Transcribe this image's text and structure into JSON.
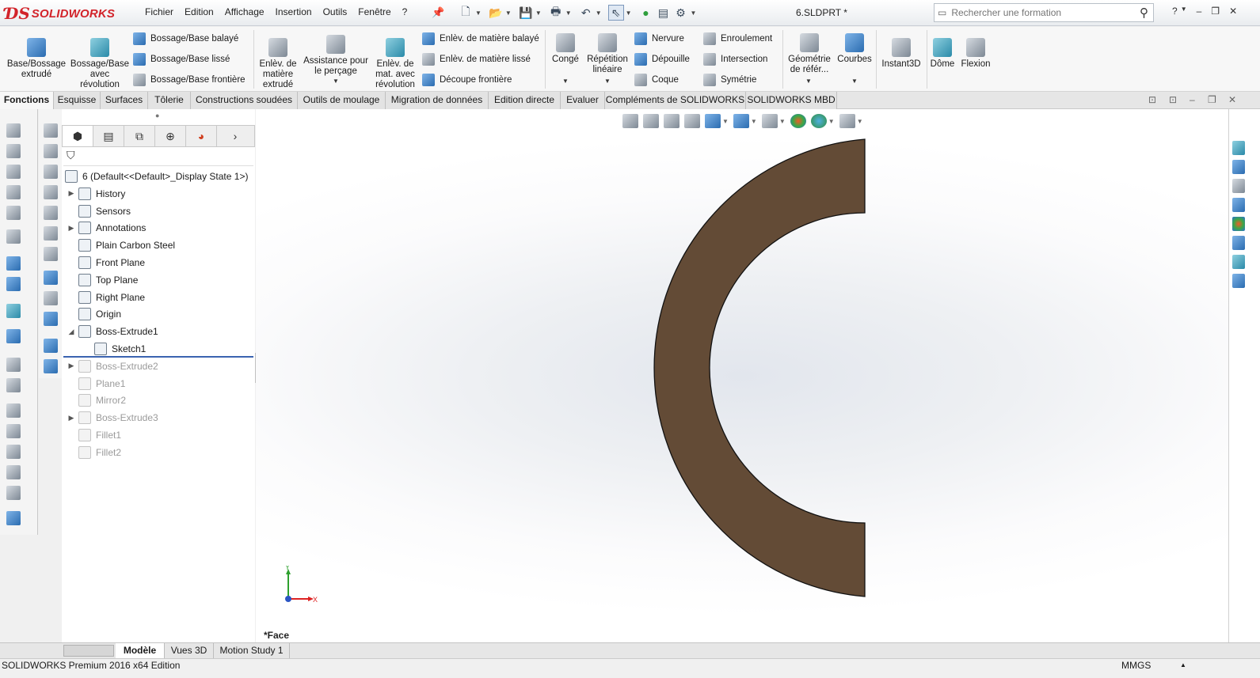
{
  "app": {
    "brand": "SOLIDWORKS",
    "doc_title": "6.SLDPRT *",
    "menus": [
      "Fichier",
      "Edition",
      "Affichage",
      "Insertion",
      "Outils",
      "Fenêtre",
      "?"
    ]
  },
  "search": {
    "placeholder": "Rechercher une formation"
  },
  "window_controls": {
    "help": "?",
    "minimize": "–",
    "restore": "❐",
    "close": "✕"
  },
  "ribbon": {
    "base_bossage_extrude": "Base/Bossage extrudé",
    "base_bossage_revolution": "Bossage/Base avec révolution",
    "bossage_balaye": "Bossage/Base balayé",
    "bossage_lisse": "Bossage/Base lissé",
    "bossage_frontiere": "Bossage/Base frontière",
    "enlev_extrude": "Enlèv. de matière extrudé",
    "assistance_percage": "Assistance pour le perçage",
    "enlev_revolution": "Enlèv. de mat. avec révolution",
    "enlev_balaye": "Enlèv. de matière balayé",
    "enlev_lisse": "Enlèv. de matière lissé",
    "decoupe_frontiere": "Découpe frontière",
    "conge": "Congé",
    "repetition_lineaire": "Répétition linéaire",
    "nervure": "Nervure",
    "depouille": "Dépouille",
    "coque": "Coque",
    "enroulement": "Enroulement",
    "intersection": "Intersection",
    "symetrie": "Symétrie",
    "geometrie_ref": "Géométrie de référ...",
    "courbes": "Courbes",
    "instant3d": "Instant3D",
    "dome": "Dôme",
    "flexion": "Flexion"
  },
  "command_tabs": [
    "Fonctions",
    "Esquisse",
    "Surfaces",
    "Tôlerie",
    "Constructions soudées",
    "Outils de moulage",
    "Migration de données",
    "Edition directe",
    "Evaluer",
    "Compléments de SOLIDWORKS",
    "SOLIDWORKS MBD"
  ],
  "feature_tree": {
    "root": "6  (Default<<Default>_Display State 1>)",
    "items": [
      {
        "label": "History",
        "expandable": true,
        "dim": false
      },
      {
        "label": "Sensors",
        "expandable": false,
        "dim": false
      },
      {
        "label": "Annotations",
        "expandable": true,
        "dim": false
      },
      {
        "label": "Plain Carbon Steel",
        "expandable": false,
        "dim": false
      },
      {
        "label": "Front Plane",
        "expandable": false,
        "dim": false
      },
      {
        "label": "Top Plane",
        "expandable": false,
        "dim": false
      },
      {
        "label": "Right Plane",
        "expandable": false,
        "dim": false
      },
      {
        "label": "Origin",
        "expandable": false,
        "dim": false
      },
      {
        "label": "Boss-Extrude1",
        "expandable": true,
        "expanded": true,
        "dim": false
      },
      {
        "label": "Sketch1",
        "child": true,
        "dim": false
      },
      {
        "label": "Boss-Extrude2",
        "expandable": true,
        "dim": true
      },
      {
        "label": "Plane1",
        "expandable": false,
        "dim": true
      },
      {
        "label": "Mirror2",
        "expandable": false,
        "dim": true
      },
      {
        "label": "Boss-Extrude3",
        "expandable": true,
        "dim": true
      },
      {
        "label": "Fillet1",
        "expandable": false,
        "dim": true
      },
      {
        "label": "Fillet2",
        "expandable": false,
        "dim": true
      }
    ]
  },
  "viewport": {
    "face_label": "*Face",
    "part_color": "#634b36",
    "triad": {
      "y": "Y",
      "x": "X"
    }
  },
  "bottom_tabs": [
    "Modèle",
    "Vues 3D",
    "Motion Study 1"
  ],
  "status": {
    "left": "SOLIDWORKS Premium 2016 x64 Edition",
    "units": "MMGS"
  }
}
